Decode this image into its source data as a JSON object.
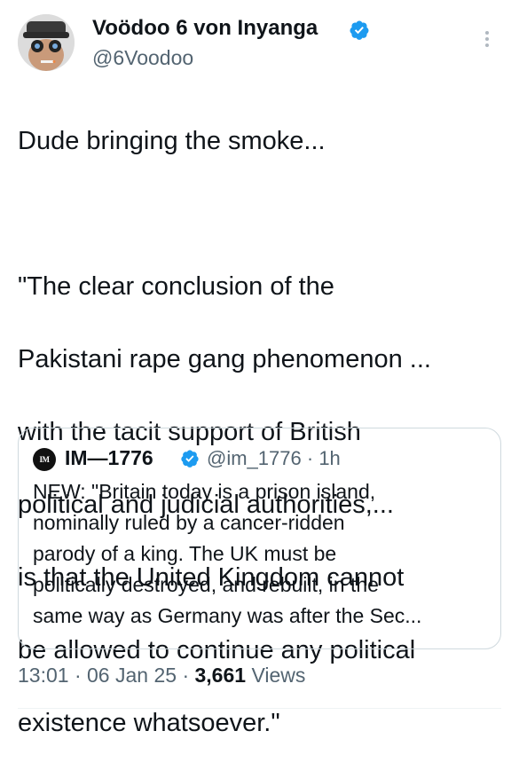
{
  "author": {
    "display_name": "Voödoo 6 von Inyanga",
    "handle": "@6Voodoo",
    "verified_icon": "verified-badge-icon",
    "avatar": "avatar"
  },
  "tweet": {
    "lines_p1": [
      "Dude bringing the smoke..."
    ],
    "lines_p2": [
      "\"The clear conclusion of the",
      "Pakistani rape gang phenomenon ...",
      "with the tacit support of British",
      "political and judicial authorities,...",
      "is that the United Kingdom cannot",
      "be allowed to continue any political",
      "existence whatsoever.\""
    ]
  },
  "quote": {
    "avatar_text": "IM",
    "display_name": "IM—1776",
    "handle": "@im_1776",
    "separator": "·",
    "time": "1h",
    "lines": [
      "NEW: \"Britain today is a prison island,",
      "nominally ruled by a cancer-ridden",
      "parody of a king. The UK must be",
      "politically destroyed, and rebuilt, in the",
      "same way as Germany was after the Sec..."
    ]
  },
  "footer": {
    "time": "13:01",
    "sep1": "·",
    "date": "06 Jan 25",
    "sep2": "·",
    "views_count": "3,661",
    "views_label": "Views"
  },
  "colors": {
    "verified_blue": "#1d9bf0",
    "text": "#0f1419",
    "muted": "#536471",
    "border": "#cfd9de"
  }
}
